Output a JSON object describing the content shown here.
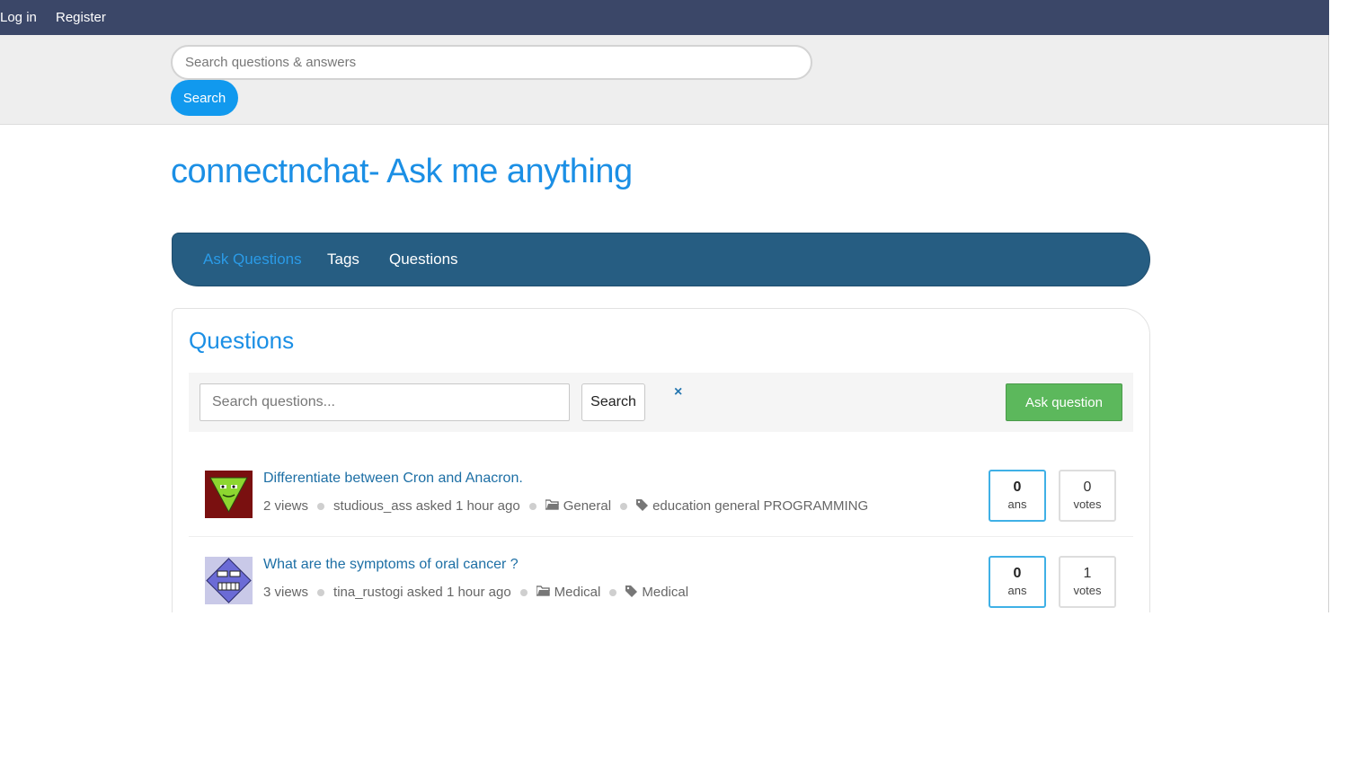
{
  "topbar": {
    "login_label": "Log in",
    "register_label": "Register"
  },
  "global_search": {
    "placeholder": "Search questions & answers",
    "button_label": "Search"
  },
  "site": {
    "title": "connectnchat- Ask me anything"
  },
  "nav": {
    "items": [
      {
        "label": "Ask Questions",
        "active": true
      },
      {
        "label": "Tags",
        "active": false
      },
      {
        "label": "Questions",
        "active": false
      }
    ]
  },
  "questions_panel": {
    "heading": "Questions",
    "search_placeholder": "Search questions...",
    "search_button": "Search",
    "clear_icon": "×",
    "ask_button": "Ask question"
  },
  "questions": [
    {
      "title": "Differentiate between Cron and Anacron.",
      "views": "2 views",
      "asked": "studious_ass asked 1 hour ago",
      "category": "General",
      "tags": "education general PROGRAMMING",
      "answers": "0",
      "answers_label": "ans",
      "votes": "0",
      "votes_label": "votes",
      "avatar_icon": "green-triangle-face-avatar"
    },
    {
      "title": "What are the symptoms of oral cancer ?",
      "views": "3 views",
      "asked": "tina_rustogi asked 1 hour ago",
      "category": "Medical",
      "tags": "Medical",
      "answers": "0",
      "answers_label": "ans",
      "votes": "1",
      "votes_label": "votes",
      "avatar_icon": "purple-diamond-face-avatar"
    }
  ],
  "colors": {
    "topbar": "#3b4768",
    "accent_blue": "#1b8fe5",
    "nav_bg": "#265d82",
    "ask_green": "#5cb85c",
    "search_btn": "#1199ee"
  }
}
